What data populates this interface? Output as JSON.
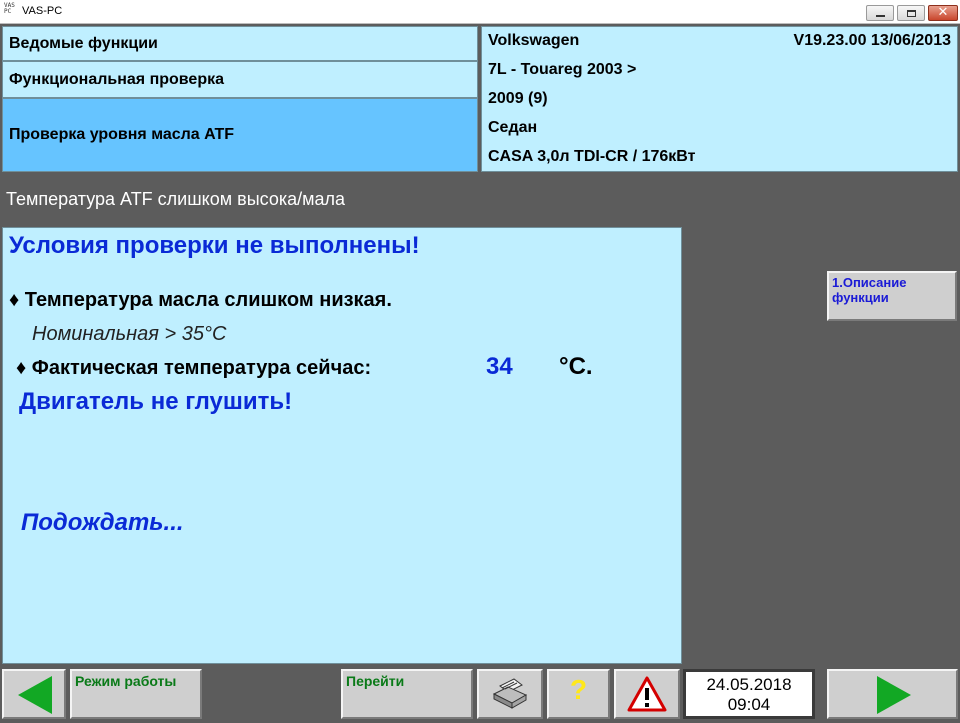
{
  "window": {
    "title": "VAS-PC",
    "icon_text": "VAS PC"
  },
  "nav": {
    "items": [
      {
        "label": "Ведомые функции"
      },
      {
        "label": "Функциональная проверка"
      },
      {
        "label": "Проверка уровня масла ATF",
        "active": true
      }
    ]
  },
  "vehicle": {
    "brand": "Volkswagen",
    "version": "V19.23.00 13/06/2013",
    "model_line1": "7L - Touareg 2003 >",
    "model_line2": "2009 (9)",
    "body": "Седан",
    "engine": "CASA 3,0л TDI-CR / 176кВт"
  },
  "status": {
    "text": "Температура ATF слишком высока/мала"
  },
  "main": {
    "warning": "Условия проверки не выполнены!",
    "condition": "♦ Температура масла слишком низкая.",
    "nominal": "Номинальная > 35°C",
    "actual_label": "♦ Фактическая температура сейчас:",
    "actual_value": "34",
    "actual_unit": "°C.",
    "engine_note": "Двигатель не глушить!",
    "wait": "Подождать..."
  },
  "side": {
    "func_button": "1.Описание функции"
  },
  "toolbar": {
    "mode_label": "Режим работы",
    "goto_label": "Перейти",
    "help_label": "?",
    "date": "24.05.2018",
    "time": "09:04"
  },
  "icons": {
    "back": "arrow-left-icon",
    "forward": "arrow-right-icon",
    "print": "printer-icon",
    "help": "question-icon",
    "warning": "warning-triangle-icon"
  },
  "colors": {
    "panel": "#bfefff",
    "active_nav": "#66c4ff",
    "background": "#5c5c5c",
    "accent_text": "#0a2ad6",
    "nav_arrow": "#12a824",
    "button_label": "#0a7a18"
  }
}
